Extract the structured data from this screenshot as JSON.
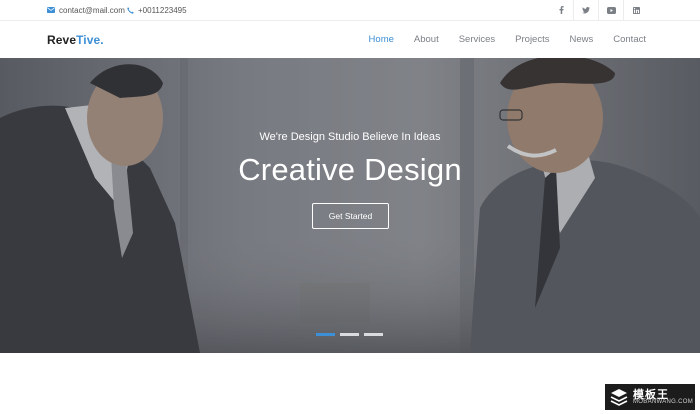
{
  "topbar": {
    "email": "contact@mail.com",
    "phone": "+0011223495",
    "socials": [
      "facebook-icon",
      "twitter-icon",
      "youtube-icon",
      "linkedin-icon"
    ]
  },
  "header": {
    "logo_main": "Reve",
    "logo_accent": "Tive.",
    "nav": [
      "Home",
      "About",
      "Services",
      "Projects",
      "News",
      "Contact"
    ],
    "active_nav": "Home"
  },
  "hero": {
    "subtitle": "We're Design Studio Believe In Ideas",
    "title": "Creative Design",
    "cta_label": "Get Started",
    "slides_total": 3,
    "active_slide": 1
  },
  "watermark": {
    "cn": "模板王",
    "en": "MOBANWANG.COM"
  },
  "colors": {
    "accent": "#3d8fd6",
    "nav_text": "#7b7f86",
    "hero_overlay": "#6e7178"
  }
}
